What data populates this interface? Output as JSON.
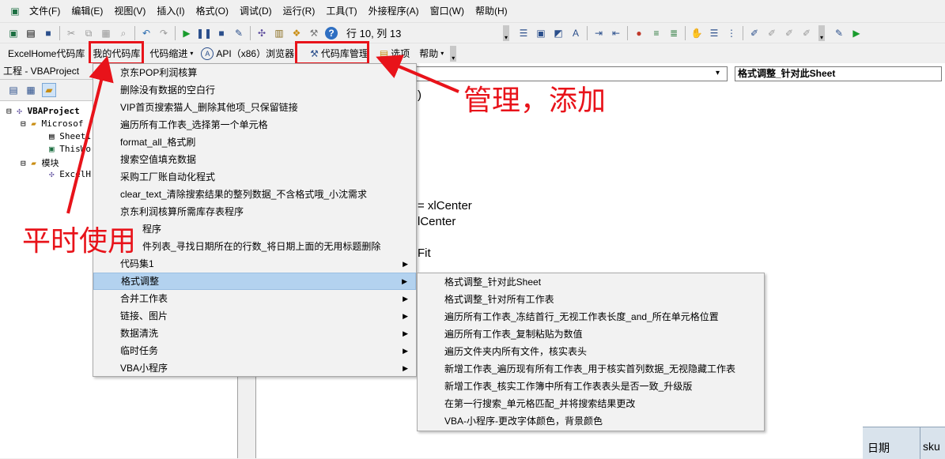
{
  "menubar": {
    "items": [
      "文件(F)",
      "编辑(E)",
      "视图(V)",
      "插入(I)",
      "格式(O)",
      "调试(D)",
      "运行(R)",
      "工具(T)",
      "外接程序(A)",
      "窗口(W)",
      "帮助(H)"
    ]
  },
  "toolbar": {
    "position": "行 10, 列 13"
  },
  "toolbar2": {
    "excelhome": "ExcelHome代码库",
    "mycode": "我的代码库",
    "indent": "代码缩进",
    "api": "API（x86）浏览器",
    "manage": "代码库管理",
    "options": "选项",
    "help": "帮助"
  },
  "project": {
    "title": "工程 - VBAProject",
    "root": "VBAProject",
    "folder1": "Microsof",
    "sheet": "Sheet1",
    "thiswb": "ThisWo",
    "folder2": "模块",
    "module": "ExcelH"
  },
  "code": {
    "proc_combo": "格式调整_针对此Sheet",
    "line1": ")",
    "line2": "= xlCenter",
    "line3": "lCenter",
    "line4": "Fit"
  },
  "menu1": {
    "items": [
      {
        "label": "京东POP利润核算",
        "sub": false
      },
      {
        "label": "删除没有数据的空白行",
        "sub": false
      },
      {
        "label": "VIP首页搜索猫人_删除其他项_只保留链接",
        "sub": false
      },
      {
        "label": "遍历所有工作表_选择第一个单元格",
        "sub": false
      },
      {
        "label": "format_all_格式刷",
        "sub": false
      },
      {
        "label": "搜索空值填充数据",
        "sub": false
      },
      {
        "label": "采购工厂账自动化程式",
        "sub": false
      },
      {
        "label": "clear_text_清除搜索结果的整列数据_不含格式哦_小沈需求",
        "sub": false
      },
      {
        "label": "京东利润核算所需库存表程序",
        "sub": false
      },
      {
        "label": "程序",
        "sub": false
      },
      {
        "label": "件列表_寻找日期所在的行数_将日期上面的无用标题删除",
        "sub": false
      },
      {
        "label": "代码集1",
        "sub": true
      },
      {
        "label": "格式调整",
        "sub": true
      },
      {
        "label": "合并工作表",
        "sub": true
      },
      {
        "label": "链接、图片",
        "sub": true
      },
      {
        "label": "数据清洗",
        "sub": true
      },
      {
        "label": "临时任务",
        "sub": true
      },
      {
        "label": "VBA小程序",
        "sub": true
      }
    ]
  },
  "menu2": {
    "items": [
      "格式调整_针对此Sheet",
      "格式调整_针对所有工作表",
      "遍历所有工作表_冻结首行_无视工作表长度_and_所在单元格位置",
      "遍历所有工作表_复制粘贴为数值",
      "遍历文件夹内所有文件，核实表头",
      "新增工作表_遍历现有所有工作表_用于核实首列数据_无视隐藏工作表",
      "新增工作表_核实工作簿中所有工作表表头是否一致_升级版",
      "在第一行搜索_单元格匹配_并将搜索结果更改",
      "VBA-小程序-更改字体颜色，背景颜色"
    ]
  },
  "annotations": {
    "manage_add": "管理，添加",
    "daily_use": "平时使用"
  },
  "sheet": {
    "cell1": "日期",
    "cell2": "sku"
  },
  "colors": {
    "annotation": "#e8131a",
    "highlight": "#b3d2ef"
  }
}
